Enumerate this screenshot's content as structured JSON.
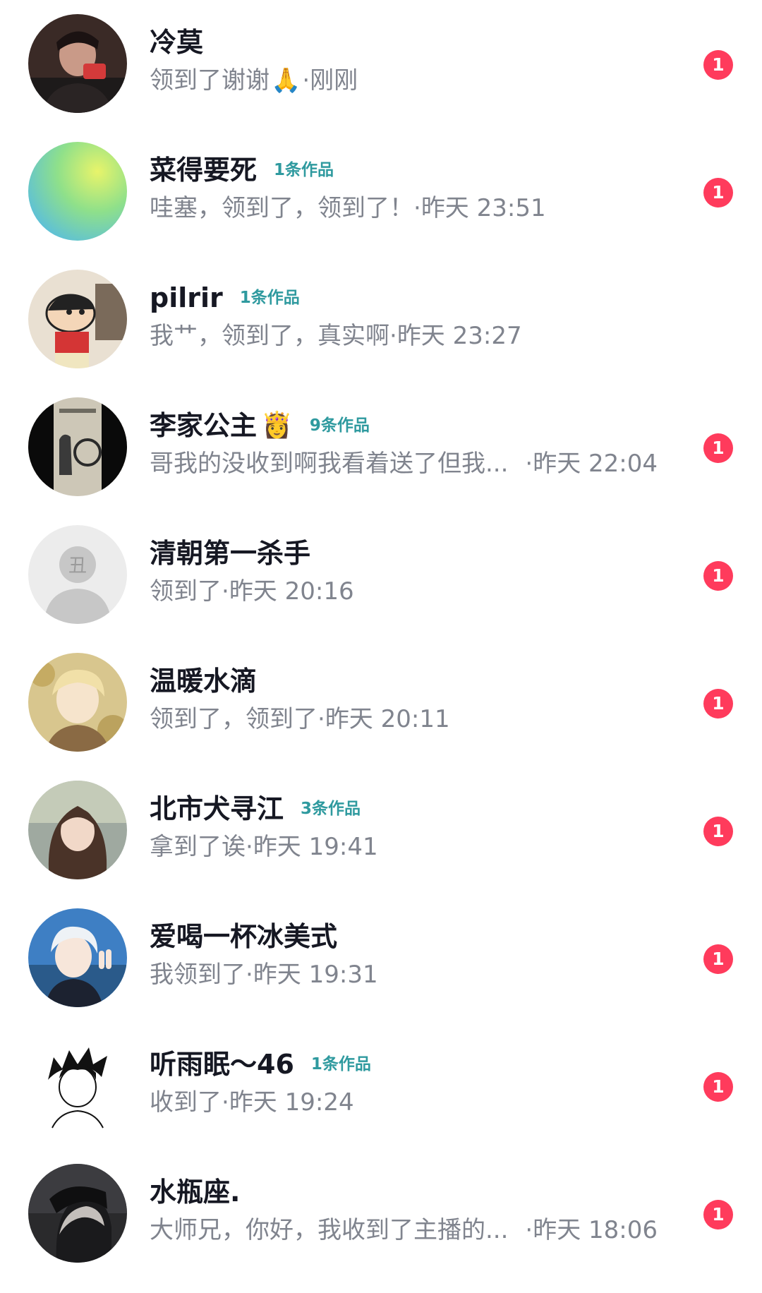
{
  "conversations": [
    {
      "name": "冷莫",
      "name_emoji": "",
      "works": "",
      "message": "领到了谢谢",
      "message_emoji": "🙏",
      "separator": "· ",
      "time": "刚刚",
      "unread": "1",
      "avatar_icon": "dark-portrait-avatar"
    },
    {
      "name": "菜得要死",
      "name_emoji": "",
      "works": "1条作品",
      "message": "哇塞，领到了，领到了！",
      "message_emoji": "",
      "separator": " · ",
      "time": "昨天 23:51",
      "unread": "1",
      "avatar_icon": "gradient-avatar"
    },
    {
      "name": "pilrir",
      "name_emoji": "",
      "works": "1条作品",
      "message": "我艹，领到了，真实啊",
      "message_emoji": "",
      "separator": "· ",
      "time": "昨天 23:27",
      "unread": "",
      "avatar_icon": "cartoon-boy-avatar"
    },
    {
      "name": "李家公主",
      "name_emoji": "👸",
      "works": "9条作品",
      "message": "哥我的没收到啊我看着送了但我...",
      "message_emoji": "",
      "separator": " · ",
      "time": "昨天 22:04",
      "unread": "1",
      "avatar_icon": "poster-avatar"
    },
    {
      "name": "清朝第一杀手",
      "name_emoji": "",
      "works": "",
      "message": "领到了",
      "message_emoji": "",
      "separator": "· ",
      "time": "昨天 20:16",
      "unread": "1",
      "avatar_icon": "default-user-avatar"
    },
    {
      "name": "温暖水滴",
      "name_emoji": "",
      "works": "",
      "message": "领到了，领到了",
      "message_emoji": "",
      "separator": "· ",
      "time": "昨天 20:11",
      "unread": "1",
      "avatar_icon": "anime-blonde-avatar"
    },
    {
      "name": "北市犬寻江",
      "name_emoji": "",
      "works": "3条作品",
      "message": "拿到了诶",
      "message_emoji": "",
      "separator": "· ",
      "time": "昨天 19:41",
      "unread": "1",
      "avatar_icon": "girl-portrait-avatar"
    },
    {
      "name": "爱喝一杯冰美式",
      "name_emoji": "",
      "works": "",
      "message": "我领到了",
      "message_emoji": "",
      "separator": "· ",
      "time": "昨天 19:31",
      "unread": "1",
      "avatar_icon": "anime-white-hair-avatar"
    },
    {
      "name": "听雨眠～46",
      "name_emoji": "",
      "works": "1条作品",
      "message": "收到了",
      "message_emoji": "",
      "separator": "· ",
      "time": "昨天 19:24",
      "unread": "1",
      "avatar_icon": "sketch-boy-avatar"
    },
    {
      "name": "水瓶座.",
      "name_emoji": "",
      "works": "",
      "message": "大师兄，你好，我收到了主播的...",
      "message_emoji": "",
      "separator": " · ",
      "time": "昨天 18:06",
      "unread": "1",
      "avatar_icon": "dark-anime-avatar"
    }
  ],
  "colors": {
    "badge": "#ff3b5c",
    "works_tag": "#2f9a9f",
    "secondary_text": "#80848e",
    "name_text": "#161823"
  }
}
